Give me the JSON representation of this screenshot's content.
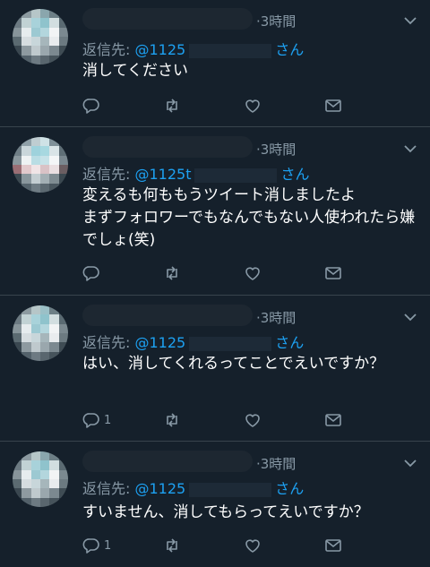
{
  "icons": {
    "reply": "reply-icon",
    "retweet": "retweet-icon",
    "like": "heart-icon",
    "dm": "envelope-icon",
    "more": "chevron-down-icon"
  },
  "colors": {
    "background": "#15202b",
    "accent": "#1da1f2",
    "muted": "#8899a6",
    "divider": "#38444d"
  },
  "tweets": [
    {
      "time": "·3時間",
      "reply_label": "返信先: ",
      "reply_handle": "@1125",
      "reply_suffix": "さん",
      "text": "消してください",
      "reply_count": "",
      "avatar_pixels": [
        "#4d5b64",
        "#8c9aa0",
        "#b6c6c8",
        "#8aa6ad",
        "#6d7f86",
        "#3d4a52",
        "#6c7a82",
        "#c1d2d4",
        "#a8d2da",
        "#8fc3cc",
        "#d2dee0",
        "#5a6a72",
        "#87949a",
        "#e6ecee",
        "#9cc9d2",
        "#b3d6dd",
        "#f2f4f5",
        "#7b8990",
        "#5b6a71",
        "#d6dde0",
        "#c8d6da",
        "#a6b6bb",
        "#e9ecee",
        "#6c7a81",
        "#3a4750",
        "#8e9aa0",
        "#bfc9cd",
        "#9aa7ad",
        "#7c8990",
        "#3f4c54",
        "#2a3640",
        "#53616a",
        "#6d7a82",
        "#59666e",
        "#46535b",
        "#2b3640"
      ]
    },
    {
      "time": "·3時間",
      "reply_label": "返信先: ",
      "reply_handle": "@1125t",
      "reply_suffix": "さん",
      "text": "変えるも何ももうツイート消しましたよ\nまずフォロワーでもなんでもない人使われたら嫌でしょ(笑)",
      "reply_count": "",
      "avatar_pixels": [
        "#4f5d66",
        "#8fa0a8",
        "#bfcdd1",
        "#cfe2e6",
        "#7f9098",
        "#3f4d55",
        "#6f7e86",
        "#c9d6da",
        "#9ed2dc",
        "#a7d8e0",
        "#d9e4e7",
        "#5f6f77",
        "#8a979d",
        "#eef2f3",
        "#b9dde4",
        "#c6e2e8",
        "#f4f6f7",
        "#7a8890",
        "#9a6e74",
        "#e2c9cc",
        "#f0e4e6",
        "#d9c2c6",
        "#eadfe1",
        "#6b5e62",
        "#3c4951",
        "#8a979d",
        "#c3cdd1",
        "#a3afb4",
        "#7f8c92",
        "#3b4850",
        "#2b3741",
        "#56646d",
        "#6f7c84",
        "#5c6971",
        "#49565e",
        "#2c3741"
      ]
    },
    {
      "time": "·3時間",
      "reply_label": "返信先: ",
      "reply_handle": "@1125",
      "reply_suffix": "さん",
      "text": "はい、消してくれるってことでえいですか？",
      "reply_count": "1",
      "avatar_pixels": [
        "#4d5b64",
        "#8c9aa0",
        "#b6c6c8",
        "#9bc0c7",
        "#6d7f86",
        "#3d4a52",
        "#6c7a82",
        "#c1d2d4",
        "#a8d2da",
        "#8fc3cc",
        "#d2dee0",
        "#5a6a72",
        "#87949a",
        "#e6ecee",
        "#9cc9d2",
        "#b3d6dd",
        "#f2f4f5",
        "#7b8990",
        "#5b6a71",
        "#d6dde0",
        "#c8d6da",
        "#a6b6bb",
        "#e9ecee",
        "#6c7a81",
        "#3a4750",
        "#8e9aa0",
        "#bfc9cd",
        "#9aa7ad",
        "#7c8990",
        "#3f4c54",
        "#2a3640",
        "#53616a",
        "#6d7a82",
        "#59666e",
        "#46535b",
        "#2b3640"
      ]
    },
    {
      "time": "·3時間",
      "reply_label": "返信先: ",
      "reply_handle": "@1125",
      "reply_suffix": "さん",
      "text": "すいません、消してもらってえいですか？",
      "reply_count": "1",
      "avatar_pixels": [
        "#4d5b64",
        "#8c9aa0",
        "#b6c6c8",
        "#8aa6ad",
        "#6d7f86",
        "#3d4a52",
        "#6c7a82",
        "#c1d2d4",
        "#a8d2da",
        "#8fc3cc",
        "#d2dee0",
        "#5a6a72",
        "#87949a",
        "#e6ecee",
        "#9cc9d2",
        "#b3d6dd",
        "#f2f4f5",
        "#7b8990",
        "#5b6a71",
        "#d6dde0",
        "#c8d6da",
        "#a6b6bb",
        "#e9ecee",
        "#6c7a81",
        "#3a4750",
        "#8e9aa0",
        "#bfc9cd",
        "#9aa7ad",
        "#7c8990",
        "#3f4c54",
        "#2a3640",
        "#53616a",
        "#6d7a82",
        "#59666e",
        "#46535b",
        "#2b3640"
      ]
    }
  ]
}
